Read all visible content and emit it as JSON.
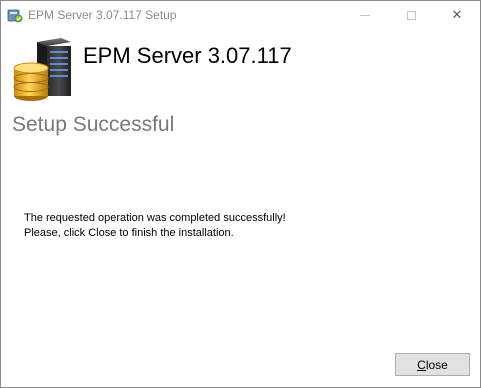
{
  "window": {
    "title": "EPM Server 3.07.117 Setup",
    "controls": {
      "minimize": "minimize",
      "maximize": "maximize",
      "close": "✕"
    }
  },
  "header": {
    "product_title": "EPM Server 3.07.117",
    "logo_icon": "server-database-icon"
  },
  "page": {
    "heading": "Setup Successful",
    "message_line1": "The requested operation was completed successfully!",
    "message_line2": "Please, click Close to finish the installation."
  },
  "footer": {
    "close_button": {
      "mnemonic": "C",
      "rest": "lose"
    }
  },
  "colors": {
    "heading_gray": "#7a7a7a",
    "title_gray": "#8c8c8c",
    "button_face": "#e1e1e1",
    "button_border": "#adadad"
  }
}
